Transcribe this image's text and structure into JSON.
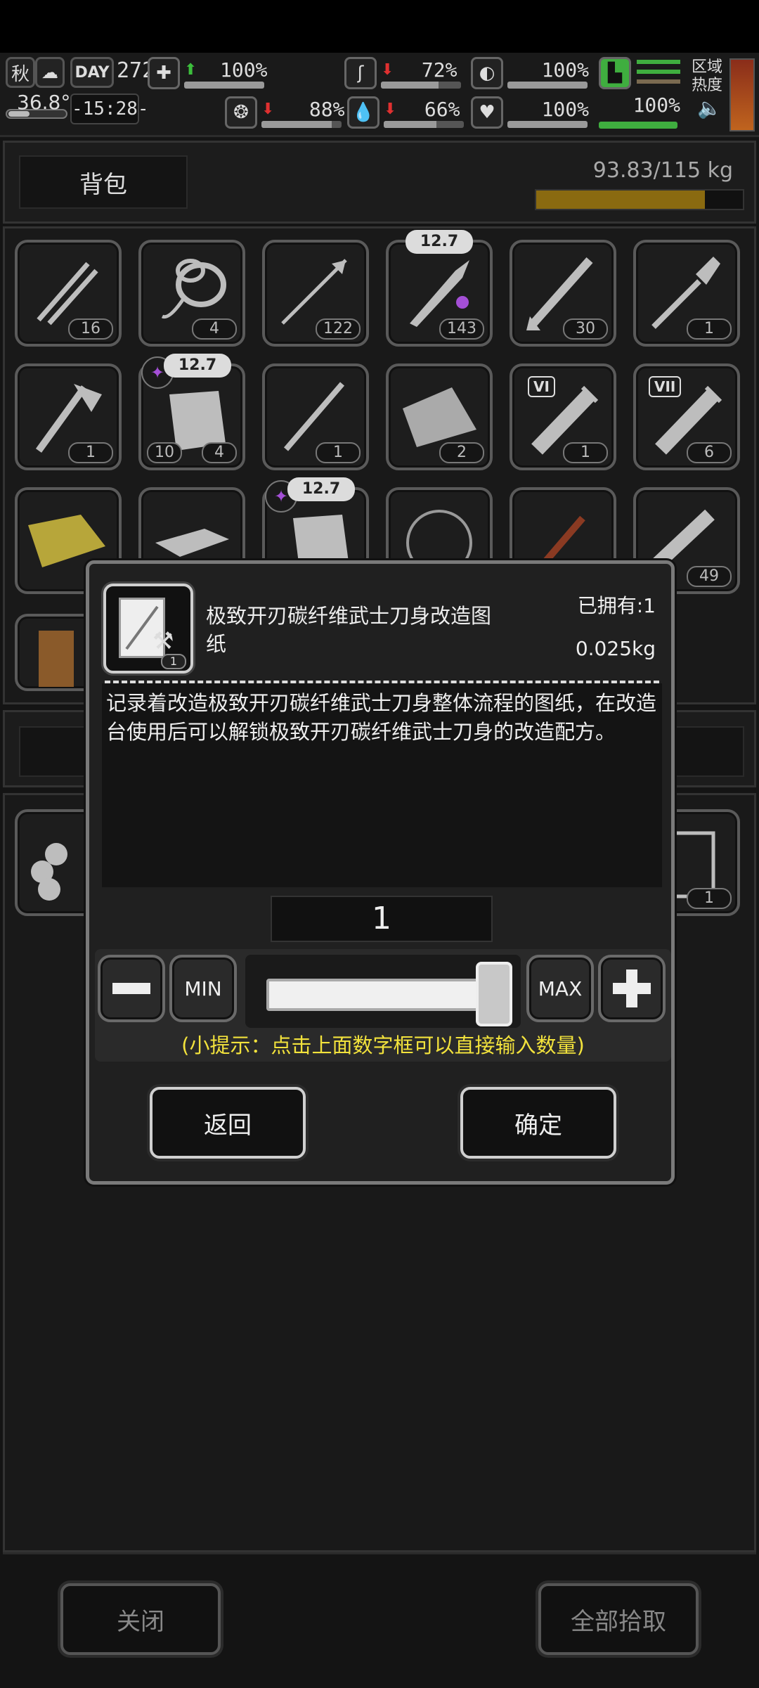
{
  "hud": {
    "season": "秋",
    "day_label": "DAY",
    "day_value": "272",
    "temperature": "36.8°C",
    "time": "-15:28-",
    "area_heat": "区域\n热度",
    "stats_top": [
      {
        "icon": "first-aid-icon",
        "trend": "up",
        "value": "100%",
        "fill": 1.0
      },
      {
        "icon": "stomach-icon",
        "trend": "down",
        "value": "72%",
        "fill": 0.72
      },
      {
        "icon": "armor-icon",
        "trend": "",
        "value": "100%",
        "fill": 1.0
      },
      {
        "icon": "boot-icon",
        "trend": "",
        "value": "100%",
        "fill": 1.0
      }
    ],
    "stats_bottom": [
      {
        "icon": "brain-icon",
        "trend": "down",
        "value": "88%",
        "fill": 0.88
      },
      {
        "icon": "water-drop-icon",
        "trend": "down",
        "value": "66%",
        "fill": 0.66
      },
      {
        "icon": "heart-icon",
        "trend": "",
        "value": "100%",
        "fill": 1.0
      }
    ]
  },
  "backpack": {
    "title": "背包",
    "weight": "93.83/115 kg",
    "weight_fill": 0.816,
    "weight_color": "#8a6a10"
  },
  "inventory": {
    "row1": [
      "16",
      "4",
      "122",
      "143",
      "30",
      "1"
    ],
    "row2": [
      "1",
      "4",
      "1",
      "2",
      "1",
      "6"
    ],
    "row2_left_count": "10",
    "row3_last": "49",
    "caliber": "12.7",
    "roman_vi": "VI",
    "roman_vii": "VII",
    "lower_right_count": "1"
  },
  "dialog": {
    "item_name": "极致开刃碳纤维武士刀身改造图纸",
    "owned": "已拥有:1",
    "weight": "0.025kg",
    "thumb_count": "1",
    "description": "记录着改造极致开刃碳纤维武士刀身整体流程的图纸，在改造台使用后可以解锁极致开刃碳纤维武士刀身的改造配方。",
    "quantity": "1",
    "min_label": "MIN",
    "max_label": "MAX",
    "hint": "(小提示：点击上面数字框可以直接输入数量)",
    "back_label": "返回",
    "confirm_label": "确定",
    "slider_fraction": 1.0
  },
  "footer": {
    "close_label": "关闭",
    "pickup_all_label": "全部拾取"
  },
  "colors": {
    "hint_yellow": "#f2e23c",
    "purple_mark": "#a44fd6",
    "heat_gradient_top": "#8a2d1a",
    "heat_gradient_bottom": "#c0641e",
    "green_bar": "#3fae3f"
  }
}
